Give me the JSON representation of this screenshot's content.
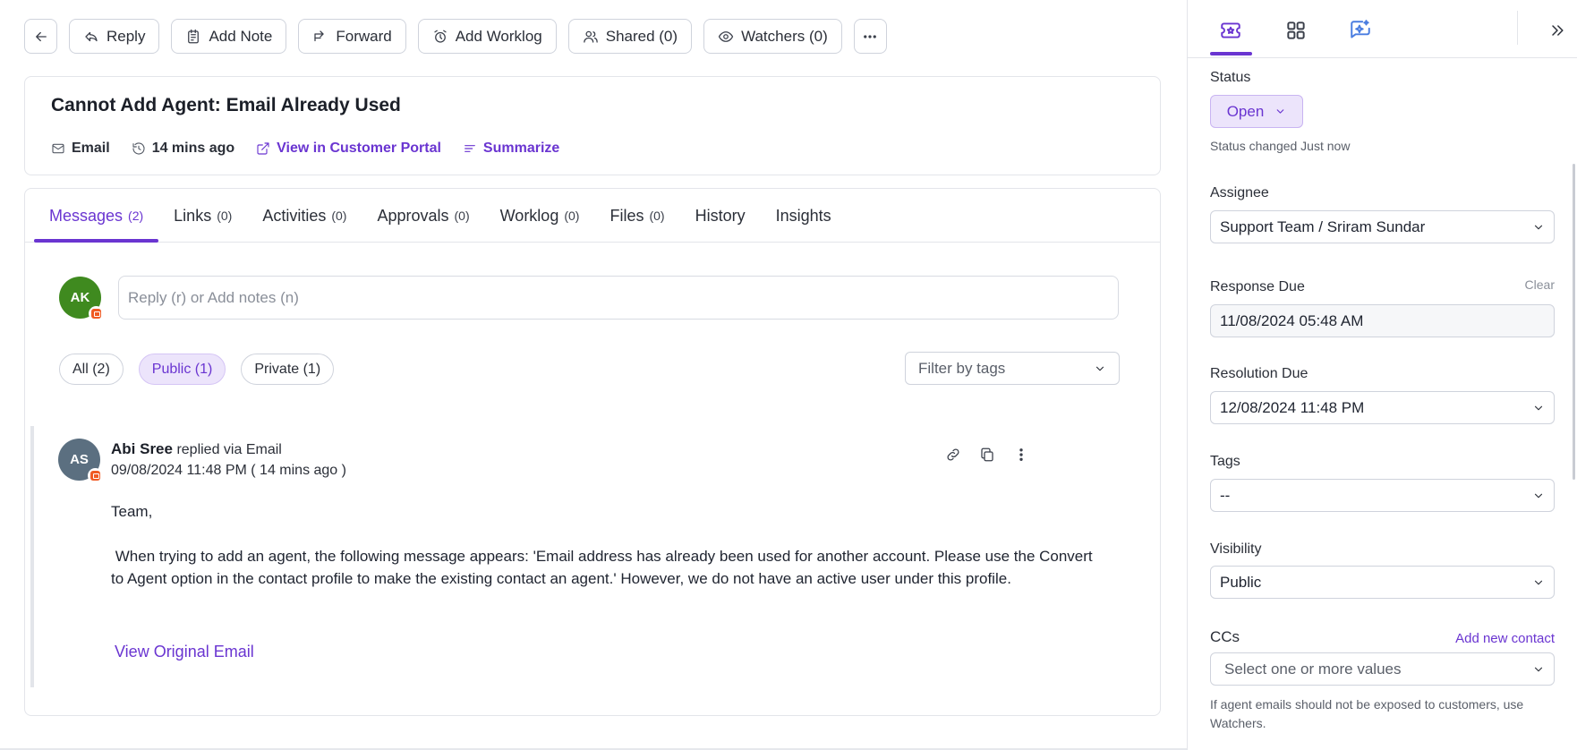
{
  "toolbar": {
    "reply": "Reply",
    "add_note": "Add Note",
    "forward": "Forward",
    "add_worklog": "Add Worklog",
    "shared": "Shared (0)",
    "watchers": "Watchers (0)"
  },
  "ticket": {
    "title": "Cannot Add Agent: Email Already Used",
    "source": "Email",
    "age": "14 mins ago",
    "portal_link": "View in Customer Portal",
    "summarize": "Summarize"
  },
  "tabs": [
    {
      "label": "Messages",
      "count": "(2)"
    },
    {
      "label": "Links",
      "count": "(0)"
    },
    {
      "label": "Activities",
      "count": "(0)"
    },
    {
      "label": "Approvals",
      "count": "(0)"
    },
    {
      "label": "Worklog",
      "count": "(0)"
    },
    {
      "label": "Files",
      "count": "(0)"
    },
    {
      "label": "History",
      "count": ""
    },
    {
      "label": "Insights",
      "count": ""
    }
  ],
  "composer": {
    "avatar_initials": "AK",
    "placeholder": "Reply (r) or Add notes (n)"
  },
  "filters": {
    "all": "All (2)",
    "public": "Public (1)",
    "private": "Private (1)",
    "tags_placeholder": "Filter by tags"
  },
  "message": {
    "avatar_initials": "AS",
    "author": "Abi Sree",
    "action": "replied via Email",
    "date": "09/08/2024 11:48 PM ( 14 mins ago )",
    "greeting": "Team,",
    "body": " When trying to add an agent, the following message appears: 'Email address has already been used for another account. Please use the Convert to Agent option in the contact profile to make the existing contact an agent.' However, we do not have an active user under this profile.",
    "view_original": "View Original Email"
  },
  "sidebar": {
    "status_label": "Status",
    "status_value": "Open",
    "status_changed": "Status changed Just now",
    "assignee_label": "Assignee",
    "assignee_value": "Support Team / Sriram Sundar",
    "response_due_label": "Response Due",
    "clear": "Clear",
    "response_due_value": "11/08/2024 05:48 AM",
    "resolution_due_label": "Resolution Due",
    "resolution_due_value": "12/08/2024 11:48 PM",
    "tags_label": "Tags",
    "tags_value": "--",
    "visibility_label": "Visibility",
    "visibility_value": "Public",
    "ccs_label": "CCs",
    "add_new_contact": "Add new contact",
    "ccs_placeholder": "Select one or more values",
    "ccs_hint": "If agent emails should not be exposed to customers, use Watchers."
  },
  "colors": {
    "accent": "#6a35d1",
    "accent_soft": "#ece4fb",
    "composer_avatar": "#3f8a1f",
    "message_avatar": "#5b6f80",
    "source_badge": "#f05a23"
  }
}
